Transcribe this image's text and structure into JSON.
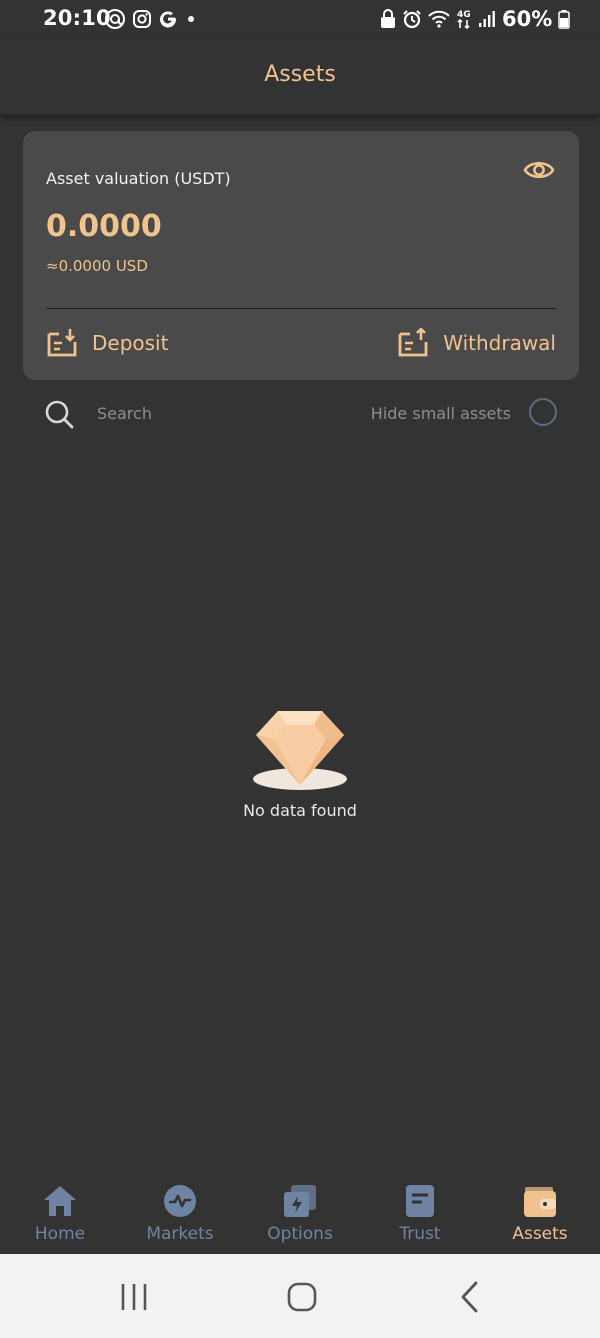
{
  "status_bar": {
    "time": "20:10",
    "battery_percent": "60%",
    "network": "4G"
  },
  "header": {
    "title": "Assets"
  },
  "valuation": {
    "label": "Asset valuation (USDT)",
    "amount": "0.0000",
    "usd_equivalent": "≈0.0000 USD",
    "deposit_label": "Deposit",
    "withdrawal_label": "Withdrawal"
  },
  "search": {
    "placeholder": "Search",
    "value": "",
    "hide_small_label": "Hide small assets",
    "hide_small_checked": false
  },
  "empty_state": {
    "text": "No data found"
  },
  "bottom_nav": {
    "items": [
      {
        "label": "Home",
        "icon": "home-icon",
        "active": false
      },
      {
        "label": "Markets",
        "icon": "markets-icon",
        "active": false
      },
      {
        "label": "Options",
        "icon": "options-icon",
        "active": false
      },
      {
        "label": "Trust",
        "icon": "trust-icon",
        "active": false
      },
      {
        "label": "Assets",
        "icon": "wallet-icon",
        "active": true
      }
    ]
  },
  "colors": {
    "background": "#333333",
    "card": "#4a4a4a",
    "accent": "#f0c38e",
    "nav_inactive": "#6f84a3",
    "system_nav": "#f2f2f2"
  }
}
